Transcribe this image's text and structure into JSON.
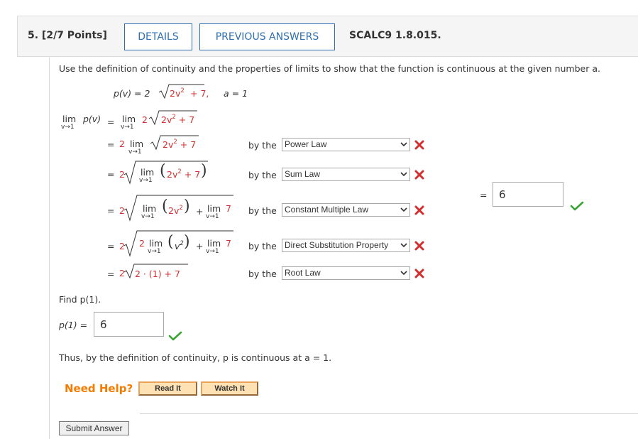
{
  "header": {
    "question": "5.  [2/7 Points]",
    "details_label": "DETAILS",
    "previous_answers_label": "PREVIOUS ANSWERS",
    "book_ref": "SCALC9 1.8.015."
  },
  "prompt": "Use the definition of continuity and the properties of limits to show that the function is continuous at the given number a.",
  "function": {
    "lhs": "p(v) = 2",
    "radicand": "2v",
    "exp": "2",
    "plus": " + 7,",
    "a_label": "a = 1"
  },
  "math": {
    "lim": "lim",
    "v_to_1": "v→1",
    "p_of_v": "p(v)",
    "eq": "=",
    "two": "2",
    "two_v": "2v",
    "v": "v",
    "sq": "2",
    "plus_seven": " + 7",
    "plus": "+",
    "seven": "7",
    "last_radicand": "2 · (1) + 7",
    "open_paren": "(",
    "close_paren": ")"
  },
  "by_the": "by the",
  "laws": [
    "Power Law",
    "Sum Law",
    "Constant Multiple Law",
    "Direct Substitution Property",
    "Root Law"
  ],
  "result": {
    "eq": "=",
    "value": "6"
  },
  "find": {
    "label": "Find p(1).",
    "lhs": "p(1) =",
    "value": "6"
  },
  "conclusion": "Thus, by the definition of continuity, p is continuous at a = 1.",
  "help": {
    "label": "Need Help?",
    "read": "Read It",
    "watch": "Watch It"
  },
  "submit_label": "Submit Answer",
  "colors": {
    "red": "#d32f2f",
    "green": "#3aa335",
    "blue": "#2f6fb0",
    "orange": "#f57c00"
  },
  "icons": {
    "incorrect": "x-mark-icon",
    "correct": "check-mark-icon",
    "dropdown": "chevron-down-icon"
  }
}
